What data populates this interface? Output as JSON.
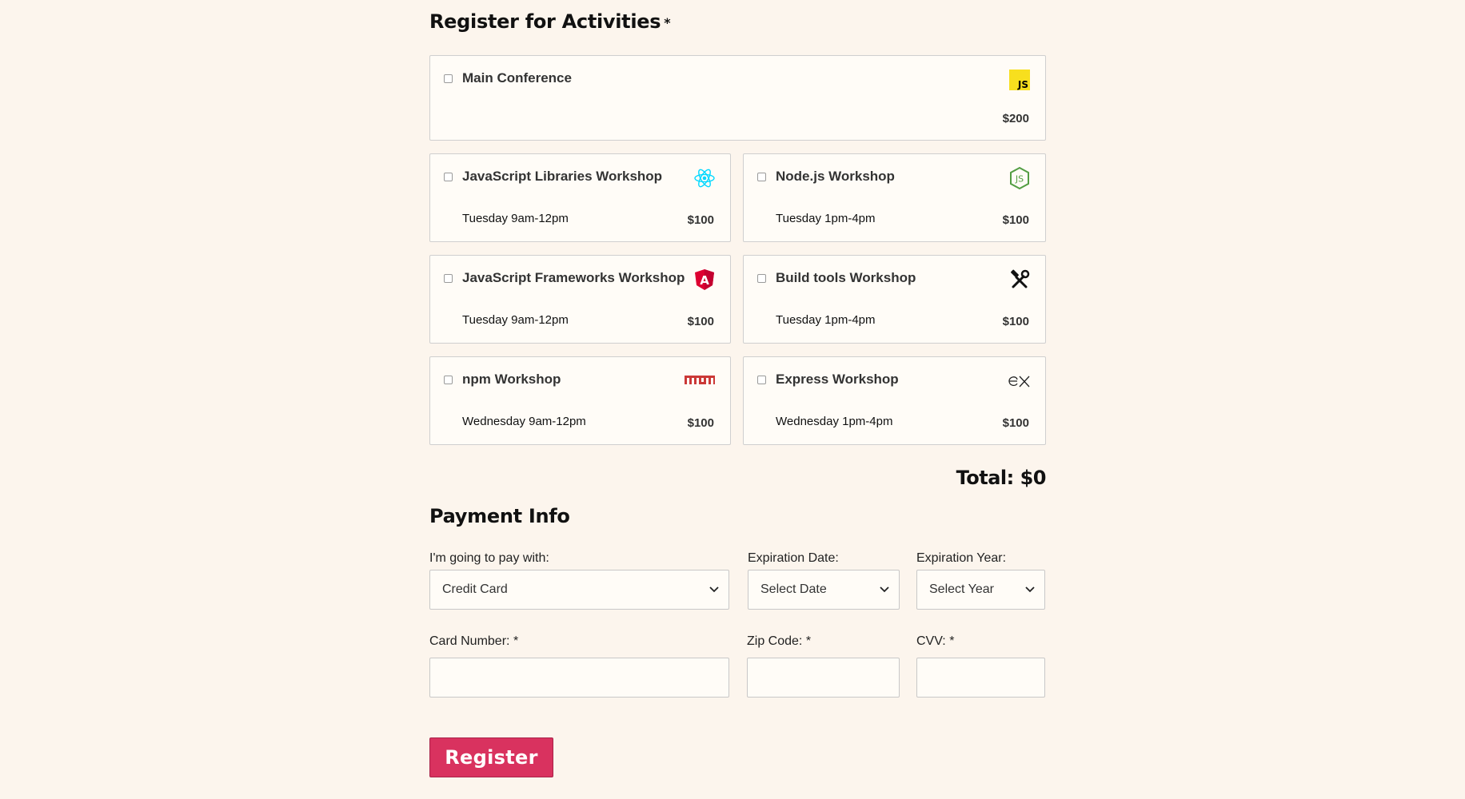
{
  "activities": {
    "title": "Register for Activities",
    "required_mark": "*",
    "items": [
      {
        "name": "Main Conference",
        "time": "",
        "price": "$200",
        "icon": "js-icon"
      },
      {
        "name": "JavaScript Libraries Workshop",
        "time": "Tuesday 9am-12pm",
        "price": "$100",
        "icon": "react-icon"
      },
      {
        "name": "Node.js Workshop",
        "time": "Tuesday 1pm-4pm",
        "price": "$100",
        "icon": "nodejs-icon"
      },
      {
        "name": "JavaScript Frameworks Workshop",
        "time": "Tuesday 9am-12pm",
        "price": "$100",
        "icon": "angular-icon"
      },
      {
        "name": "Build tools Workshop",
        "time": "Tuesday 1pm-4pm",
        "price": "$100",
        "icon": "tools-icon"
      },
      {
        "name": "npm Workshop",
        "time": "Wednesday 9am-12pm",
        "price": "$100",
        "icon": "npm-icon"
      },
      {
        "name": "Express Workshop",
        "time": "Wednesday 1pm-4pm",
        "price": "$100",
        "icon": "express-icon"
      }
    ],
    "total": "Total: $0"
  },
  "payment": {
    "title": "Payment Info",
    "pay_with_label": "I'm going to pay with:",
    "pay_with_value": "Credit Card",
    "exp_date_label": "Expiration Date:",
    "exp_date_value": "Select Date",
    "exp_year_label": "Expiration Year:",
    "exp_year_value": "Select Year",
    "card_number_label": "Card Number:",
    "zip_label": "Zip Code:",
    "cvv_label": "CVV:",
    "required_mark": "*",
    "card_number_value": "",
    "zip_value": "",
    "cvv_value": ""
  },
  "submit": {
    "label": "Register"
  },
  "colors": {
    "background": "#fcf5ed",
    "button": "#d9325f",
    "js_yellow": "#f7df1e",
    "react": "#00d8ff",
    "node_green": "#539e43",
    "angular_red": "#dd0031",
    "npm_red": "#cb3837"
  }
}
